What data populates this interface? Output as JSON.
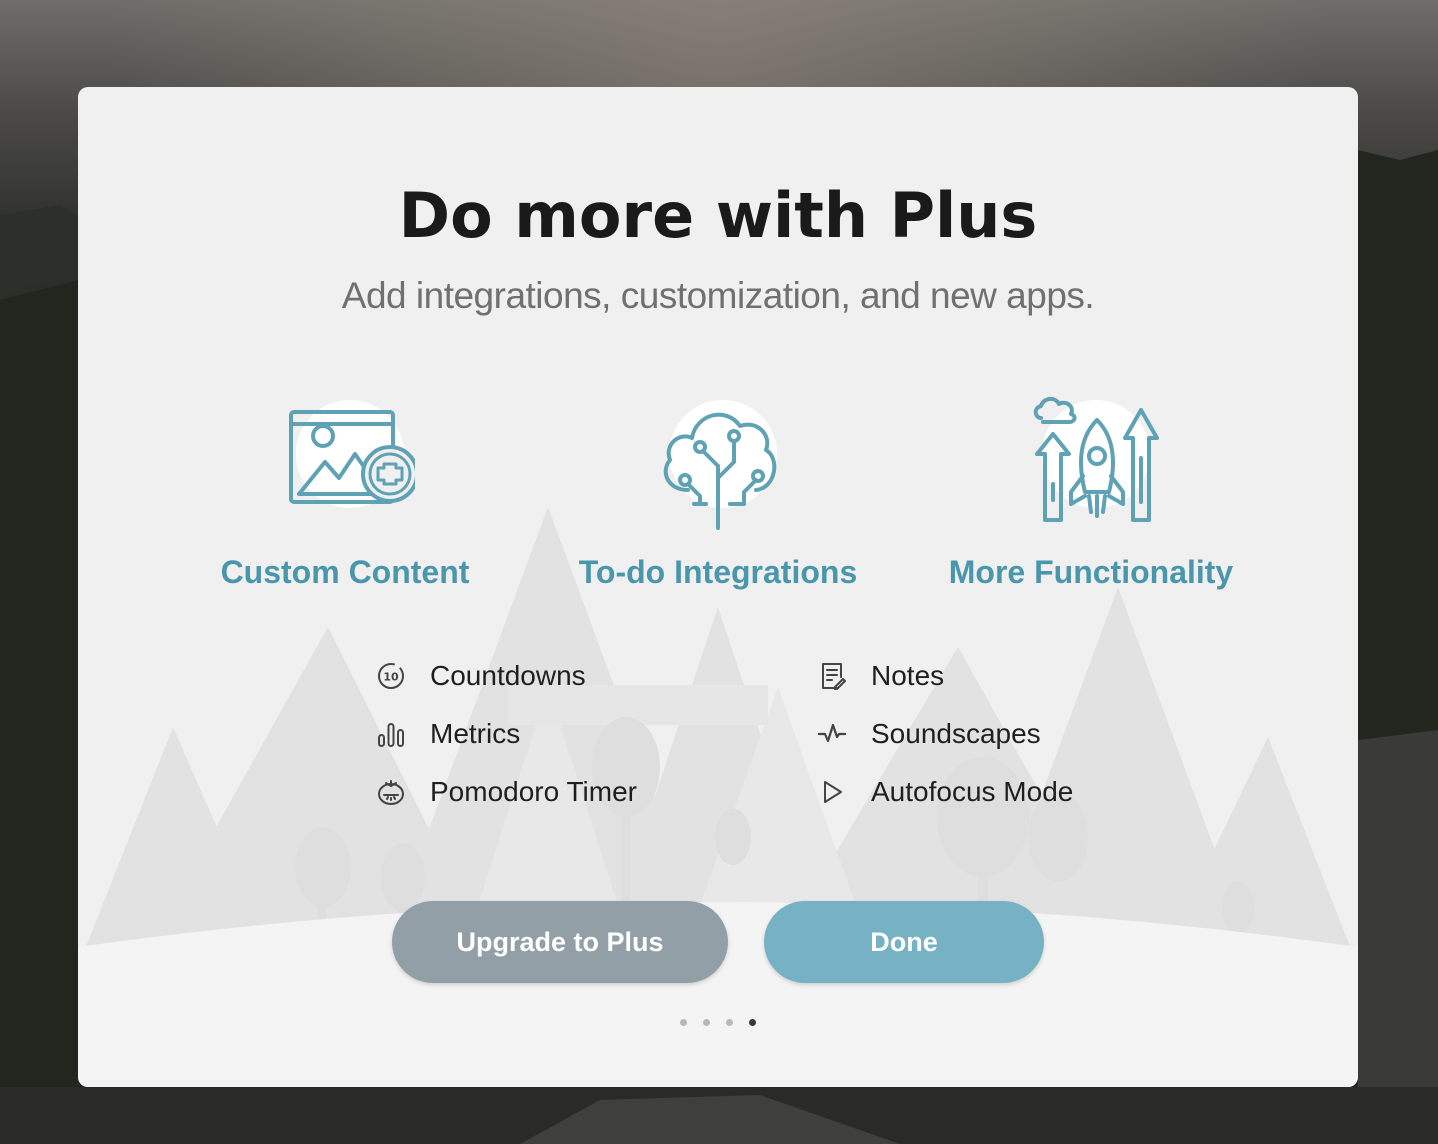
{
  "modal": {
    "title": "Do more with Plus",
    "subtitle": "Add integrations, customization, and new apps."
  },
  "features": [
    {
      "label": "Custom Content",
      "icon": "image-add-icon"
    },
    {
      "label": "To-do Integrations",
      "icon": "cloud-tree-icon"
    },
    {
      "label": "More Functionality",
      "icon": "rocket-arrows-icon"
    }
  ],
  "apps_left": [
    {
      "label": "Countdowns",
      "icon": "countdown-icon"
    },
    {
      "label": "Metrics",
      "icon": "metrics-icon"
    },
    {
      "label": "Pomodoro Timer",
      "icon": "tomato-timer-icon"
    }
  ],
  "apps_right": [
    {
      "label": "Notes",
      "icon": "notes-icon"
    },
    {
      "label": "Soundscapes",
      "icon": "waveform-icon"
    },
    {
      "label": "Autofocus Mode",
      "icon": "play-icon"
    }
  ],
  "buttons": {
    "upgrade": "Upgrade to Plus",
    "done": "Done"
  },
  "pagination": {
    "total": 4,
    "active": 4
  },
  "countdown_icon_text": "10",
  "colors": {
    "accent": "#4a97ad",
    "upgrade_button": "#929fa6",
    "done_button": "#76b2c4",
    "modal_bg": "#f0f0f0"
  }
}
